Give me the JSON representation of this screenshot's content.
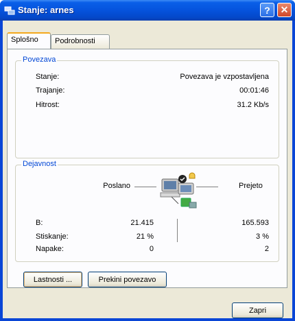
{
  "window": {
    "title": "Stanje: arnes",
    "help_label": "?",
    "close_label": "✕"
  },
  "tabs": [
    {
      "label": "Splošno",
      "active": true
    },
    {
      "label": "Podrobnosti",
      "active": false
    }
  ],
  "connection": {
    "legend": "Povezava",
    "status_label": "Stanje:",
    "status_value": "Povezava je vzpostavljena",
    "duration_label": "Trajanje:",
    "duration_value": "00:01:46",
    "speed_label": "Hitrost:",
    "speed_value": "31.2 Kb/s"
  },
  "activity": {
    "legend": "Dejavnost",
    "sent_header": "Poslano",
    "received_header": "Prejeto",
    "rows": [
      {
        "label": "B:",
        "sent": "21.415",
        "received": "165.593"
      },
      {
        "label": "Stiskanje:",
        "sent": "21 %",
        "received": "3 %"
      },
      {
        "label": "Napake:",
        "sent": "0",
        "received": "2"
      }
    ]
  },
  "buttons": {
    "properties": "Lastnosti ...",
    "disconnect": "Prekini povezavo",
    "close": "Zapri"
  },
  "icons": {
    "title_icon": "network-connection-icon",
    "activity_icon": "network-activity-computers-icon"
  }
}
